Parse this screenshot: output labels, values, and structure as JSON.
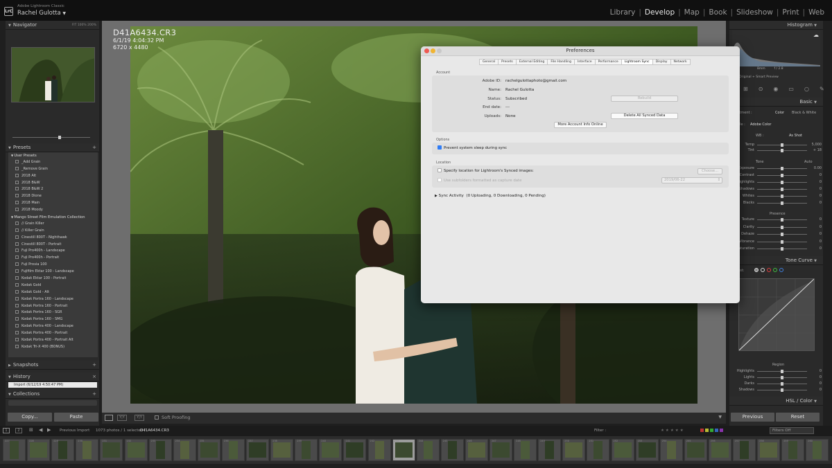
{
  "app": {
    "product": "Adobe Lightroom Classic",
    "user": "Rachel Gulotta",
    "logo": "LrC",
    "modules": [
      "Library",
      "Develop",
      "Map",
      "Book",
      "Slideshow",
      "Print",
      "Web"
    ],
    "active_module": "Develop"
  },
  "left_panel": {
    "navigator": {
      "title": "Navigator",
      "zoom_options": [
        "FIT",
        "100%",
        "200%"
      ]
    },
    "presets": {
      "title": "Presets",
      "groups": [
        {
          "name": "User Presets",
          "items": [
            "_Add Grain",
            "_Remove Grain",
            "2018 Alt",
            "2018 B&W",
            "2018 B&W 2",
            "2018 Dione",
            "2018 Main",
            "2018 Moody"
          ]
        },
        {
          "name": "Mango Street Film Emulation Collection",
          "items": [
            "// Grain Killer",
            "// Killer Grain",
            "Cinestill 800T - Nighthawk",
            "Cinestill 800T - Portrait",
            "Fuji Pro400h - Landscape",
            "Fuji Pro400h - Portrait",
            "Fuji Provia 100",
            "Fujifilm Ektar 100 - Landscape",
            "Kodak Ektar 100 - Portrait",
            "Kodak Gold",
            "Kodak Gold - Alt",
            "Kodak Portra 160 - Landscape",
            "Kodak Portra 160 - Portrait",
            "Kodak Portra 160 - SGR",
            "Kodak Portra 160 - SMG",
            "Kodak Portra 400 - Landscape",
            "Kodak Portra 400 - Portrait",
            "Kodak Portra 400 - Portrait Alt",
            "Kodak Tri-X 400 (BONUS)"
          ]
        }
      ]
    },
    "snapshots": "Snapshots",
    "history": {
      "title": "History",
      "items": [
        "Import (6/12/19 4:50:47 PM)"
      ]
    },
    "collections": "Collections",
    "copy_label": "Copy...",
    "paste_label": "Paste"
  },
  "image": {
    "filename": "D41A6434.CR3",
    "datetime": "6/1/19 4:04:32 PM",
    "dimensions": "6720 x 4480"
  },
  "toolbar": {
    "soft_proofing": "Soft Proofing"
  },
  "right_panel": {
    "histogram": "Histogram",
    "hist_info": [
      "8mm",
      "f / 2.8"
    ],
    "original_label": "Original + Smart Preview",
    "basic": {
      "title": "Basic",
      "treatment_label": "Treatment :",
      "color": "Color",
      "bw": "Black & White",
      "profile_label": "Profile :",
      "profile": "Adobe Color",
      "wb_label": "WB :",
      "wb_value": "As Shot",
      "sliders": [
        {
          "name": "Temp",
          "value": "5,000"
        },
        {
          "name": "Tint",
          "value": "+ 18"
        }
      ]
    },
    "tone": {
      "title": "Tone",
      "auto": "Auto",
      "sliders": [
        {
          "name": "Exposure",
          "value": "0.00"
        },
        {
          "name": "Contrast",
          "value": "0"
        },
        {
          "name": "Highlights",
          "value": "0"
        },
        {
          "name": "Shadows",
          "value": "0"
        },
        {
          "name": "Whites",
          "value": "0"
        },
        {
          "name": "Blacks",
          "value": "0"
        }
      ]
    },
    "presence": {
      "title": "Presence",
      "sliders": [
        {
          "name": "Texture",
          "value": "0"
        },
        {
          "name": "Clarity",
          "value": "0"
        },
        {
          "name": "Dehaze",
          "value": "0"
        },
        {
          "name": "Vibrance",
          "value": "0"
        },
        {
          "name": "Saturation",
          "value": "0"
        }
      ]
    },
    "tone_curve": {
      "title": "Tone Curve",
      "adjust_label": "Adjust:",
      "region": "Region",
      "sliders": [
        {
          "name": "Highlights",
          "value": "0"
        },
        {
          "name": "Lights",
          "value": "0"
        },
        {
          "name": "Darks",
          "value": "0"
        },
        {
          "name": "Shadows",
          "value": "0"
        }
      ]
    },
    "hsl": "HSL / Color",
    "previous_label": "Previous",
    "reset_label": "Reset"
  },
  "filmstrip": {
    "source": "Previous Import",
    "count_text": "1073 photos / 1 selected /",
    "selected_file": "D41A6434.CR3",
    "filter_label": "Filter :",
    "filters_off": "Filters Off",
    "page_numbers": [
      "1",
      "2"
    ],
    "thumb_numbers": [
      "227",
      "228",
      "229",
      "230",
      "231",
      "232",
      "233",
      "234",
      "235",
      "236",
      "237",
      "238",
      "239",
      "240",
      "241",
      "242",
      "243",
      "244",
      "245",
      "246",
      "247",
      "248",
      "249",
      "250",
      "251",
      "252",
      "253",
      "254",
      "255",
      "256",
      "257",
      "258",
      "259",
      "260"
    ]
  },
  "preferences": {
    "title": "Preferences",
    "tabs": [
      "General",
      "Presets",
      "External Editing",
      "File Handling",
      "Interface",
      "Performance",
      "Lightroom Sync",
      "Display",
      "Network"
    ],
    "active_tab": "Lightroom Sync",
    "account": {
      "label": "Account",
      "rows": [
        {
          "key": "Adobe ID:",
          "value": "rachelgulottaphoto@gmail.com"
        },
        {
          "key": "Name:",
          "value": "Rachel Gulotta"
        },
        {
          "key": "Status:",
          "value": "Subscribed"
        },
        {
          "key": "End date:",
          "value": "---"
        },
        {
          "key": "Uploads:",
          "value": "None"
        }
      ],
      "rebuild_button": "Rebuild",
      "delete_button": "Delete All Synced Data",
      "more_info_button": "More Account Info Online"
    },
    "options": {
      "label": "Options",
      "prevent_sleep": "Prevent system sleep during sync"
    },
    "location": {
      "label": "Location",
      "specify": "Specify location for Lightroom's Synced images:",
      "choose_button": "Choose...",
      "subfolders": "Use subfolders formatted as capture date",
      "date_format": "2019/06-22"
    },
    "sync_activity": "Sync Activity",
    "sync_status": "(0 Uploading, 0 Downloading, 0 Pending)"
  }
}
